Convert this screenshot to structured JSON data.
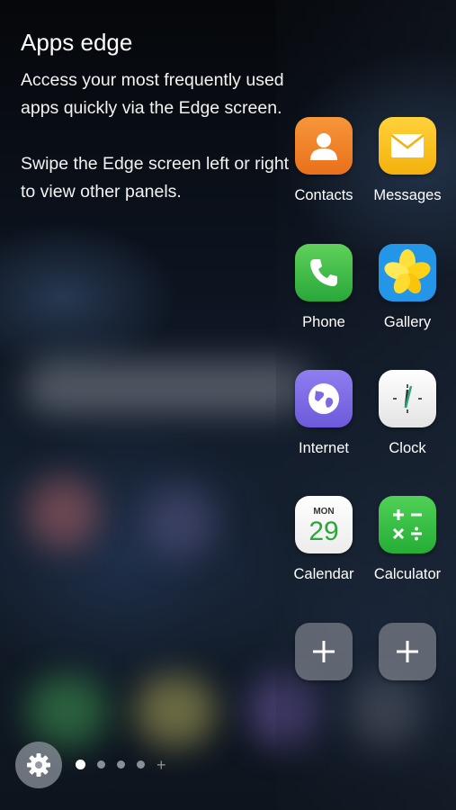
{
  "panel": {
    "title": "Apps edge",
    "description_1": "Access your most frequently used apps quickly via the Edge screen.",
    "description_2": "Swipe the Edge screen left or right to view other panels."
  },
  "apps": [
    {
      "label": "Contacts",
      "icon": "contacts-icon",
      "color": "#ef7f25"
    },
    {
      "label": "Messages",
      "icon": "messages-icon",
      "color": "#f9c21b"
    },
    {
      "label": "Phone",
      "icon": "phone-icon",
      "color": "#3bbb45"
    },
    {
      "label": "Gallery",
      "icon": "gallery-icon",
      "color": "#2496e8"
    },
    {
      "label": "Internet",
      "icon": "internet-icon",
      "color": "#7b6ae4"
    },
    {
      "label": "Clock",
      "icon": "clock-icon",
      "color": "#f2f2f2"
    },
    {
      "label": "Calendar",
      "icon": "calendar-icon",
      "color": "#f5f5f5",
      "month": "MON",
      "day": "29"
    },
    {
      "label": "Calculator",
      "icon": "calculator-icon",
      "color": "#39be44"
    }
  ],
  "add_buttons": [
    {
      "icon": "plus-icon"
    },
    {
      "icon": "plus-icon"
    }
  ],
  "footer": {
    "settings_icon": "gear-icon",
    "page_count": 4,
    "active_page": 1,
    "add_panel_glyph": "+"
  }
}
